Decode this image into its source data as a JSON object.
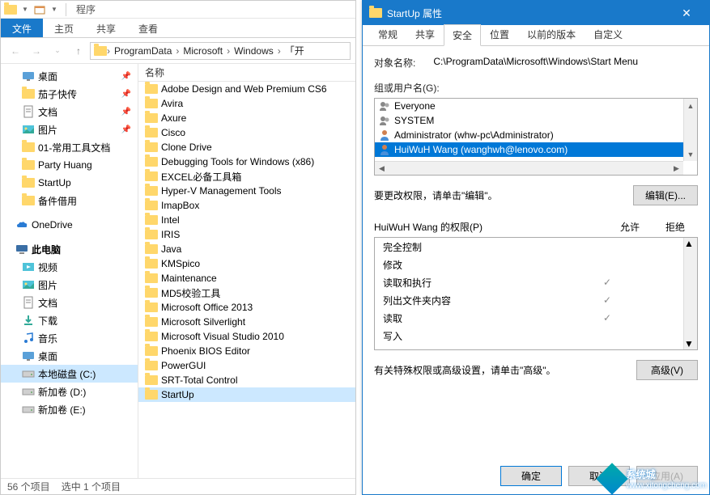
{
  "explorer": {
    "title": "程序",
    "tabs": {
      "file": "文件",
      "home": "主页",
      "share": "共享",
      "view": "查看"
    },
    "breadcrumb": [
      "ProgramData",
      "Microsoft",
      "Windows",
      "「开"
    ],
    "tree": {
      "quick": [
        {
          "label": "桌面",
          "icon": "desktop",
          "pinned": true
        },
        {
          "label": "茄子快传",
          "icon": "folder",
          "pinned": true
        },
        {
          "label": "文档",
          "icon": "document",
          "pinned": true
        },
        {
          "label": "图片",
          "icon": "picture",
          "pinned": true
        },
        {
          "label": "01-常用工具文档",
          "icon": "folder",
          "pinned": false
        },
        {
          "label": "Party Huang",
          "icon": "folder",
          "pinned": false
        },
        {
          "label": "StartUp",
          "icon": "folder",
          "pinned": false
        },
        {
          "label": "备件借用",
          "icon": "folder",
          "pinned": false
        }
      ],
      "onedrive": "OneDrive",
      "thispc": "此电脑",
      "pcitems": [
        {
          "label": "视频",
          "icon": "video"
        },
        {
          "label": "图片",
          "icon": "picture"
        },
        {
          "label": "文档",
          "icon": "document"
        },
        {
          "label": "下载",
          "icon": "download"
        },
        {
          "label": "音乐",
          "icon": "music"
        },
        {
          "label": "桌面",
          "icon": "desktop"
        },
        {
          "label": "本地磁盘 (C:)",
          "icon": "drive",
          "selected": true
        },
        {
          "label": "新加卷 (D:)",
          "icon": "drive"
        },
        {
          "label": "新加卷 (E:)",
          "icon": "drive"
        }
      ]
    },
    "list": {
      "header": "名称",
      "items": [
        "Adobe Design and Web Premium CS6",
        "Avira",
        "Axure",
        "Cisco",
        "Clone Drive",
        "Debugging Tools for Windows (x86)",
        "EXCEL必备工具箱",
        "Hyper-V Management Tools",
        "ImapBox",
        "Intel",
        "IRIS",
        "Java",
        "KMSpico",
        "Maintenance",
        "MD5校验工具",
        "Microsoft Office 2013",
        "Microsoft Silverlight",
        "Microsoft Visual Studio 2010",
        "Phoenix BIOS Editor",
        "PowerGUI",
        "SRT-Total Control",
        "StartUp"
      ],
      "selected": "StartUp"
    },
    "status": {
      "total": "56 个项目",
      "selected": "选中 1 个项目"
    }
  },
  "props": {
    "title": "StartUp 属性",
    "tabs": [
      "常规",
      "共享",
      "安全",
      "位置",
      "以前的版本",
      "自定义"
    ],
    "active_tab": "安全",
    "object_label": "对象名称:",
    "object_value": "C:\\ProgramData\\Microsoft\\Windows\\Start Menu",
    "group_label": "组或用户名(G):",
    "users": [
      {
        "name": "Everyone",
        "type": "group"
      },
      {
        "name": "SYSTEM",
        "type": "group"
      },
      {
        "name": "Administrator (whw-pc\\Administrator)",
        "type": "user"
      },
      {
        "name": "HuiWuH Wang (wanghwh@lenovo.com)",
        "type": "user",
        "selected": true
      }
    ],
    "edit_hint": "要更改权限，请单击\"编辑\"。",
    "edit_btn": "编辑(E)...",
    "perm_header": "HuiWuH Wang 的权限(P)",
    "perm_allow": "允许",
    "perm_deny": "拒绝",
    "permissions": [
      {
        "name": "完全控制",
        "allow": false,
        "deny": false
      },
      {
        "name": "修改",
        "allow": false,
        "deny": false
      },
      {
        "name": "读取和执行",
        "allow": true,
        "deny": false
      },
      {
        "name": "列出文件夹内容",
        "allow": true,
        "deny": false
      },
      {
        "name": "读取",
        "allow": true,
        "deny": false
      },
      {
        "name": "写入",
        "allow": false,
        "deny": false
      }
    ],
    "adv_hint": "有关特殊权限或高级设置，请单击\"高级\"。",
    "adv_btn": "高级(V)",
    "ok_btn": "确定",
    "cancel_btn": "取消",
    "apply_btn": "应用(A)"
  },
  "watermark": {
    "brand": "系统城",
    "url": "www.xitongcheng.com"
  }
}
